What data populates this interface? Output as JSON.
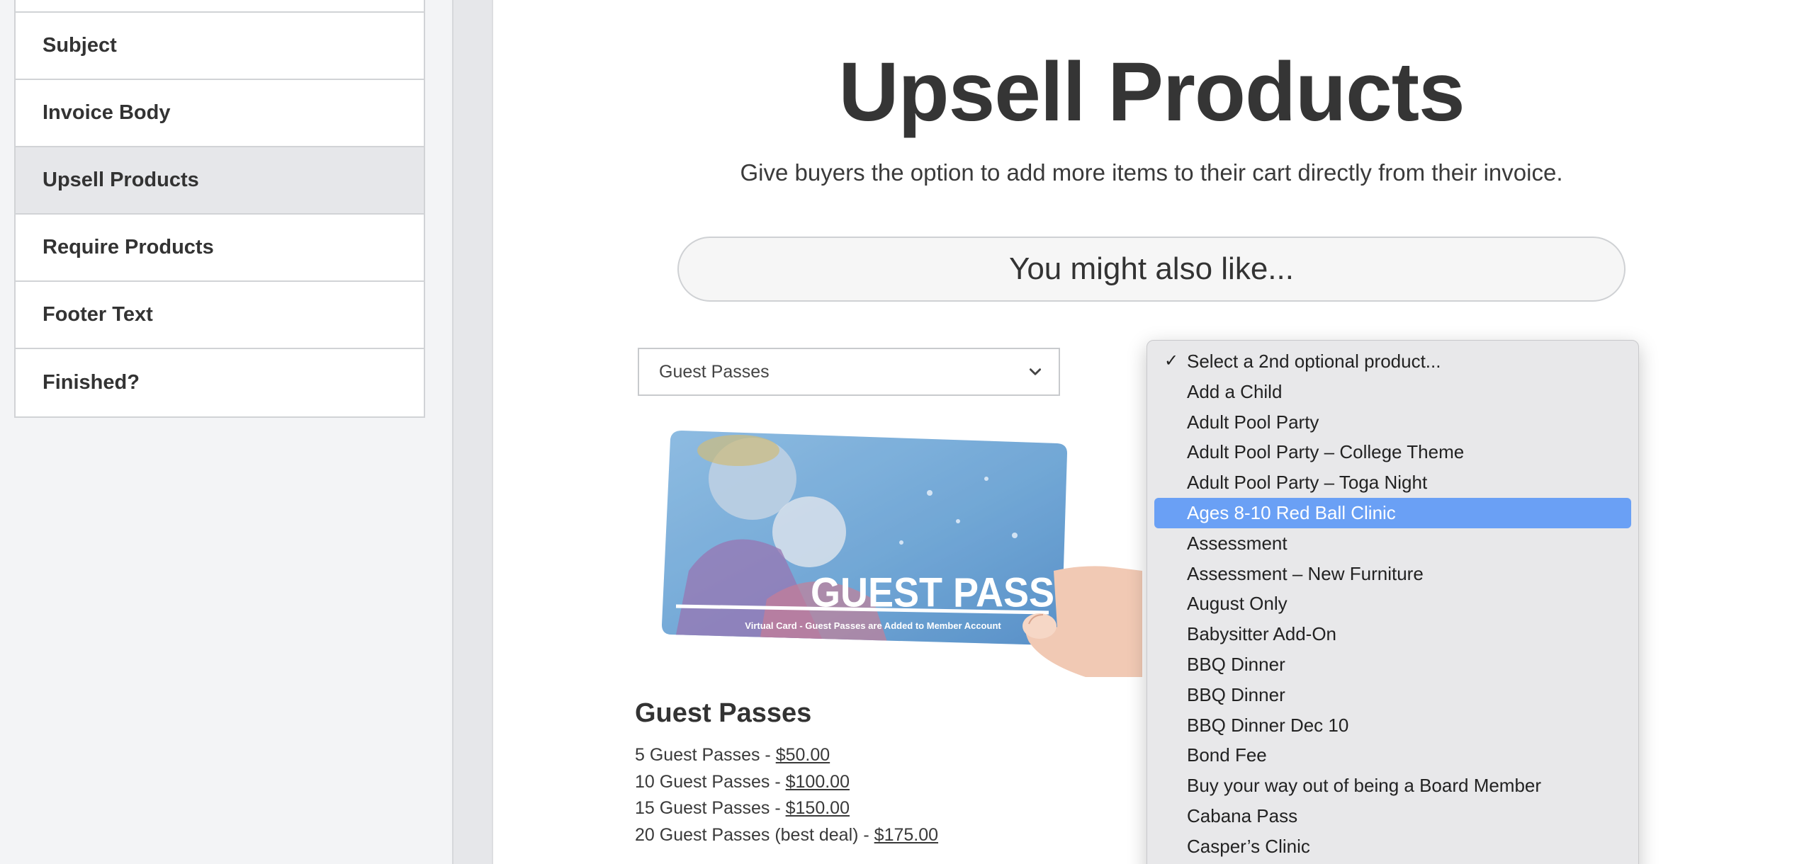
{
  "sidebar": {
    "items": [
      {
        "label": "Subject",
        "active": false
      },
      {
        "label": "Invoice Body",
        "active": false
      },
      {
        "label": "Upsell Products",
        "active": true
      },
      {
        "label": "Require Products",
        "active": false
      },
      {
        "label": "Footer Text",
        "active": false
      },
      {
        "label": "Finished?",
        "active": false
      }
    ]
  },
  "main": {
    "title": "Upsell Products",
    "subtitle": "Give buyers the option to add more items to their cart directly from their invoice.",
    "section_heading": "You might also like...",
    "first_select": {
      "selected": "Guest Passes",
      "icon": "chevron-down-icon"
    },
    "product": {
      "image_text": "GUEST PASS",
      "image_caption": "Virtual Card - Guest Passes are Added to Member Account",
      "name": "Guest Passes",
      "prices": [
        {
          "label": "5 Guest Passes - ",
          "price": "$50.00"
        },
        {
          "label": "10 Guest Passes - ",
          "price": "$100.00"
        },
        {
          "label": "15 Guest Passes - ",
          "price": "$150.00"
        },
        {
          "label": "20 Guest Passes (best deal) - ",
          "price": "$175.00"
        }
      ]
    },
    "second_select": {
      "check_icon": "✓",
      "options": [
        "Select a 2nd optional product...",
        "Add a Child",
        "Adult Pool Party",
        "Adult Pool Party – College Theme",
        "Adult Pool Party – Toga Night",
        "Ages 8-10 Red Ball Clinic",
        "Assessment",
        "Assessment – New Furniture",
        "August Only",
        "Babysitter Add-On",
        "BBQ Dinner",
        "BBQ Dinner",
        "BBQ Dinner Dec 10",
        "Bond Fee",
        "Buy your way out of being a Board Member",
        "Cabana Pass",
        "Casper’s Clinic"
      ],
      "checked_index": 0,
      "highlighted_index": 5,
      "highlight_color": "#6aa0f5"
    }
  }
}
